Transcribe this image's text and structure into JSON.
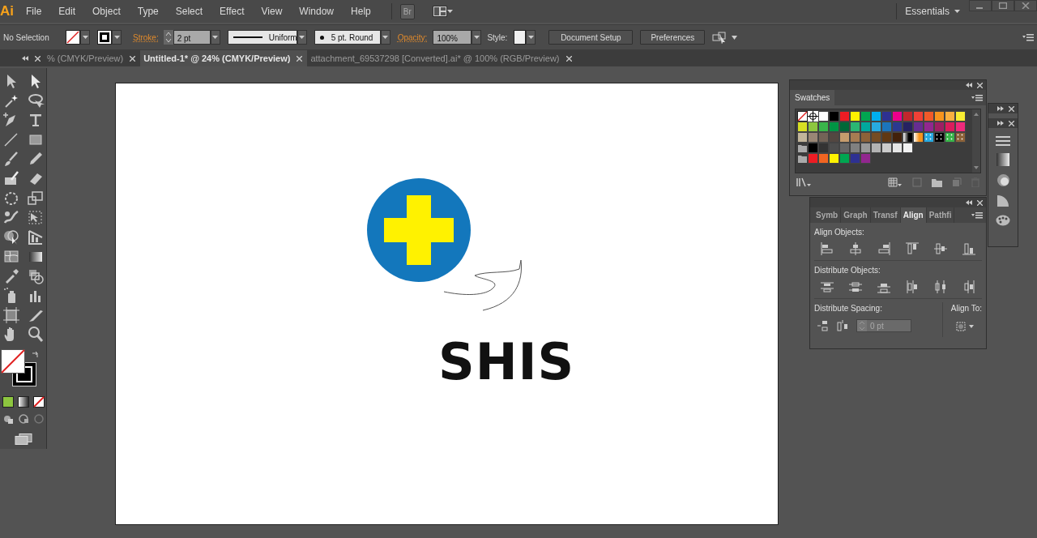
{
  "app": {
    "logo": "Ai",
    "bridge_button": "Br"
  },
  "menu": [
    "File",
    "Edit",
    "Object",
    "Type",
    "Select",
    "Effect",
    "View",
    "Window",
    "Help"
  ],
  "workspace": {
    "label": "Essentials"
  },
  "control_bar": {
    "selection": "No Selection",
    "stroke_label": "Stroke:",
    "stroke_weight": "2 pt",
    "stroke_profile": "Uniform",
    "brush": "5 pt. Round",
    "opacity_label": "Opacity:",
    "opacity": "100%",
    "style_label": "Style:",
    "buttons": [
      "Document Setup",
      "Preferences"
    ]
  },
  "document_tabs": [
    {
      "label": "% (CMYK/Preview)",
      "selected": false
    },
    {
      "label": "Untitled-1* @ 24% (CMYK/Preview)",
      "selected": true
    },
    {
      "label": "attachment_69537298 [Converted].ai* @ 100% (RGB/Preview)",
      "selected": false
    }
  ],
  "artboard": {
    "text": "SHIS"
  },
  "swatches": {
    "title": "Swatches",
    "rows": [
      [
        {
          "kind": "none"
        },
        {
          "kind": "registration"
        },
        {
          "kind": "color",
          "color": "#ffffff"
        },
        {
          "kind": "color",
          "color": "#000000"
        },
        {
          "kind": "color",
          "color": "#ed1c24"
        },
        {
          "kind": "color",
          "color": "#fff200"
        },
        {
          "kind": "color",
          "color": "#00a651"
        },
        {
          "kind": "color",
          "color": "#00aeef"
        },
        {
          "kind": "color",
          "color": "#2e3192"
        },
        {
          "kind": "color",
          "color": "#ec008c"
        },
        {
          "kind": "color",
          "color": "#c1272d"
        },
        {
          "kind": "color",
          "color": "#ef4136"
        },
        {
          "kind": "color",
          "color": "#f15a29"
        },
        {
          "kind": "color",
          "color": "#f7941d"
        },
        {
          "kind": "color",
          "color": "#fbb040"
        },
        {
          "kind": "color",
          "color": "#f9ed32"
        }
      ],
      [
        {
          "kind": "color",
          "color": "#d7df23"
        },
        {
          "kind": "color",
          "color": "#8dc63f"
        },
        {
          "kind": "color",
          "color": "#39b54a"
        },
        {
          "kind": "color",
          "color": "#009444"
        },
        {
          "kind": "color",
          "color": "#006838"
        },
        {
          "kind": "color",
          "color": "#2bb673"
        },
        {
          "kind": "color",
          "color": "#00a79d"
        },
        {
          "kind": "color",
          "color": "#27aae1"
        },
        {
          "kind": "color",
          "color": "#1c75bc"
        },
        {
          "kind": "color",
          "color": "#2b3990"
        },
        {
          "kind": "color",
          "color": "#262262"
        },
        {
          "kind": "color",
          "color": "#662d91"
        },
        {
          "kind": "color",
          "color": "#92278f"
        },
        {
          "kind": "color",
          "color": "#9e1f63"
        },
        {
          "kind": "color",
          "color": "#da1c5c"
        },
        {
          "kind": "color",
          "color": "#ee2a7b"
        }
      ],
      [
        {
          "kind": "color",
          "color": "#c2b59b"
        },
        {
          "kind": "color",
          "color": "#998675"
        },
        {
          "kind": "color",
          "color": "#736357"
        },
        {
          "kind": "color",
          "color": "#534741"
        },
        {
          "kind": "color",
          "color": "#c69c6d"
        },
        {
          "kind": "color",
          "color": "#a67c52"
        },
        {
          "kind": "color",
          "color": "#8c6239"
        },
        {
          "kind": "color",
          "color": "#754c24"
        },
        {
          "kind": "color",
          "color": "#603813"
        },
        {
          "kind": "color",
          "color": "#42210b"
        },
        {
          "kind": "gradient",
          "color": "#000000"
        },
        {
          "kind": "gradient",
          "color": "#f7941d"
        },
        {
          "kind": "pattern",
          "color": "#27aae1"
        },
        {
          "kind": "pattern",
          "color": "#000000"
        },
        {
          "kind": "pattern",
          "color": "#39b54a"
        },
        {
          "kind": "pattern",
          "color": "#8c6239"
        }
      ],
      [
        {
          "kind": "folder"
        },
        {
          "kind": "color",
          "color": "#000000"
        },
        {
          "kind": "color",
          "color": "#333333"
        },
        {
          "kind": "color",
          "color": "#4d4d4d"
        },
        {
          "kind": "color",
          "color": "#666666"
        },
        {
          "kind": "color",
          "color": "#808080"
        },
        {
          "kind": "color",
          "color": "#999999"
        },
        {
          "kind": "color",
          "color": "#b3b3b3"
        },
        {
          "kind": "color",
          "color": "#cccccc"
        },
        {
          "kind": "color",
          "color": "#e6e6e6"
        },
        {
          "kind": "color",
          "color": "#f2f2f2"
        }
      ],
      [
        {
          "kind": "folder"
        },
        {
          "kind": "color",
          "color": "#ed1c24"
        },
        {
          "kind": "color",
          "color": "#f26522"
        },
        {
          "kind": "color",
          "color": "#fff200"
        },
        {
          "kind": "color",
          "color": "#00a651"
        },
        {
          "kind": "color",
          "color": "#2e3192"
        },
        {
          "kind": "color",
          "color": "#92278f"
        }
      ]
    ]
  },
  "panel_tabs": [
    {
      "label": "Symb",
      "selected": false
    },
    {
      "label": "Graph",
      "selected": false
    },
    {
      "label": "Transf",
      "selected": false
    },
    {
      "label": "Align",
      "selected": true
    },
    {
      "label": "Pathfi",
      "selected": false
    }
  ],
  "align_panel": {
    "align_objects": "Align Objects:",
    "distribute_objects": "Distribute Objects:",
    "distribute_spacing": "Distribute Spacing:",
    "spacing_value": "0 pt",
    "align_to": "Align To:"
  }
}
